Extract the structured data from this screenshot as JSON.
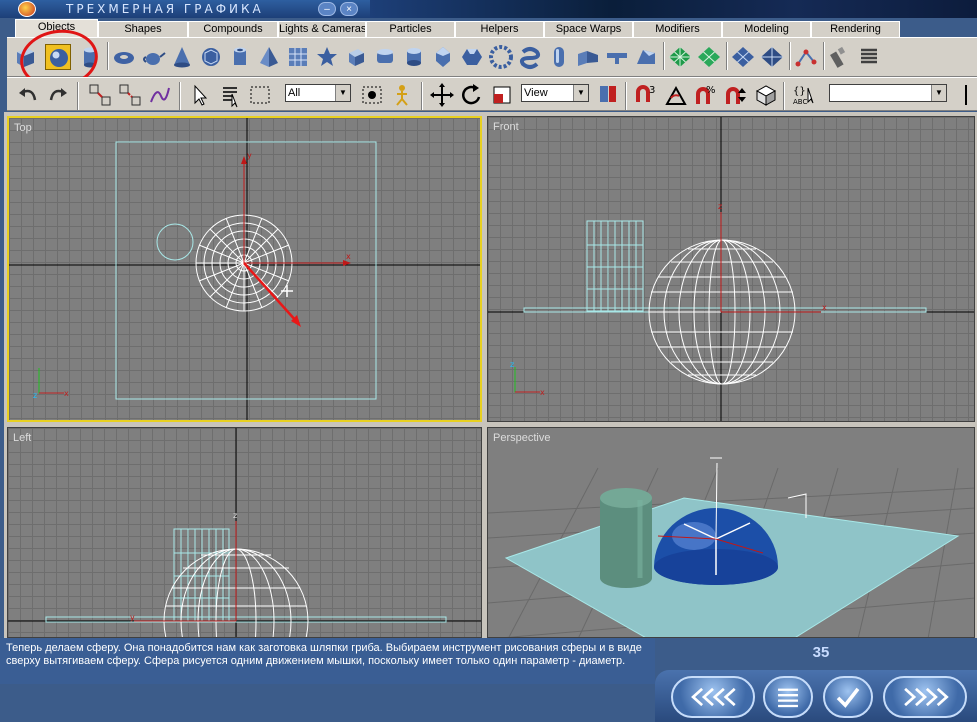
{
  "window": {
    "title": "ТРЕХМЕРНАЯ ГРАФИКА",
    "minimize_label": "–",
    "close_label": "×"
  },
  "tabs": [
    {
      "label": "Objects",
      "active": true
    },
    {
      "label": "Shapes"
    },
    {
      "label": "Compounds"
    },
    {
      "label": "Lights & Cameras"
    },
    {
      "label": "Particles"
    },
    {
      "label": "Helpers"
    },
    {
      "label": "Space Warps"
    },
    {
      "label": "Modifiers"
    },
    {
      "label": "Modeling"
    },
    {
      "label": "Rendering"
    }
  ],
  "toolbar": {
    "object_icons": [
      "box-icon",
      "sphere-icon",
      "cylinder-icon",
      "torus-icon",
      "teapot-icon",
      "cone-icon",
      "geosphere-icon",
      "tube-icon",
      "pyramid-icon",
      "plane-icon",
      "hedra-icon",
      "chamferbox-icon",
      "chamfercyl-icon",
      "oiltank-icon",
      "spindle-icon",
      "gengon-icon",
      "ringwave-icon",
      "torusknot-icon",
      "capsule-icon",
      "lext-icon",
      "cext-icon",
      "prism-icon",
      "grid-icon",
      "patch-icon",
      "nurbs-icon",
      "surface-icon",
      "bones-icon",
      "spray-icon",
      "spring-icon"
    ],
    "selected_icon": "sphere-icon",
    "filter_combo": "All",
    "coord_combo": "View",
    "named_selection_value": ""
  },
  "viewports": {
    "top": {
      "label": "Top",
      "active": true
    },
    "front": {
      "label": "Front"
    },
    "left": {
      "label": "Left"
    },
    "perspective": {
      "label": "Perspective"
    }
  },
  "description": "Теперь делаем сферу. Она понадобится нам как заготовка шляпки гриба. Выбираем инструмент рисования сферы и в виде сверху вытягиваем сферу. Сфера рисуется одним движением мышки, поскольку имеет только один параметр - диаметр.",
  "page_number": "35",
  "nav": [
    "first-page-button",
    "prev-page-button",
    "contents-button",
    "check-button",
    "next-page-button"
  ],
  "colors": {
    "accent_yellow": "#e8d020",
    "highlight_red": "#e01515",
    "panel_blue": "#3c5c8a",
    "sphere_blue": "#1c4fa8",
    "cyan_object": "#a8e8e8"
  }
}
